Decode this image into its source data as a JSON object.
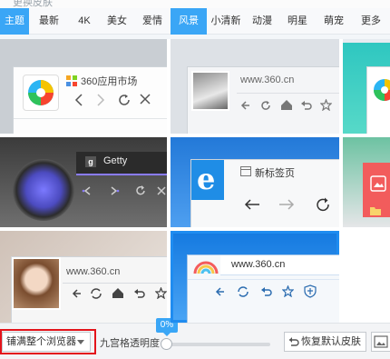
{
  "window": {
    "title": "更换皮肤"
  },
  "tabs": [
    {
      "label": "主题",
      "active": true
    },
    {
      "label": "最新"
    },
    {
      "label": "4K"
    },
    {
      "label": "美女"
    },
    {
      "label": "爱情"
    },
    {
      "label": "风景",
      "active": true
    },
    {
      "label": "小清新"
    },
    {
      "label": "动漫"
    },
    {
      "label": "明星"
    },
    {
      "label": "萌宠"
    },
    {
      "label": "更多"
    }
  ],
  "cards": {
    "store": {
      "title": "360应用市场"
    },
    "portrait1": {
      "url": "www.360.cn"
    },
    "getty": {
      "title": "Getty"
    },
    "newtab": {
      "title": "新标签页"
    },
    "portrait2": {
      "url": "www.360.cn"
    },
    "cartoon": {
      "url": "www.360.cn"
    }
  },
  "bottom": {
    "fill_mode": "铺满整个浏览器",
    "opacity_label": "九宫格透明度",
    "opacity_value": "0%",
    "restore_label": "恢复默认皮肤"
  },
  "colors": {
    "accent": "#3aa6f6",
    "highlight": "#e3141b",
    "ie_blue": "#1f8de6"
  }
}
